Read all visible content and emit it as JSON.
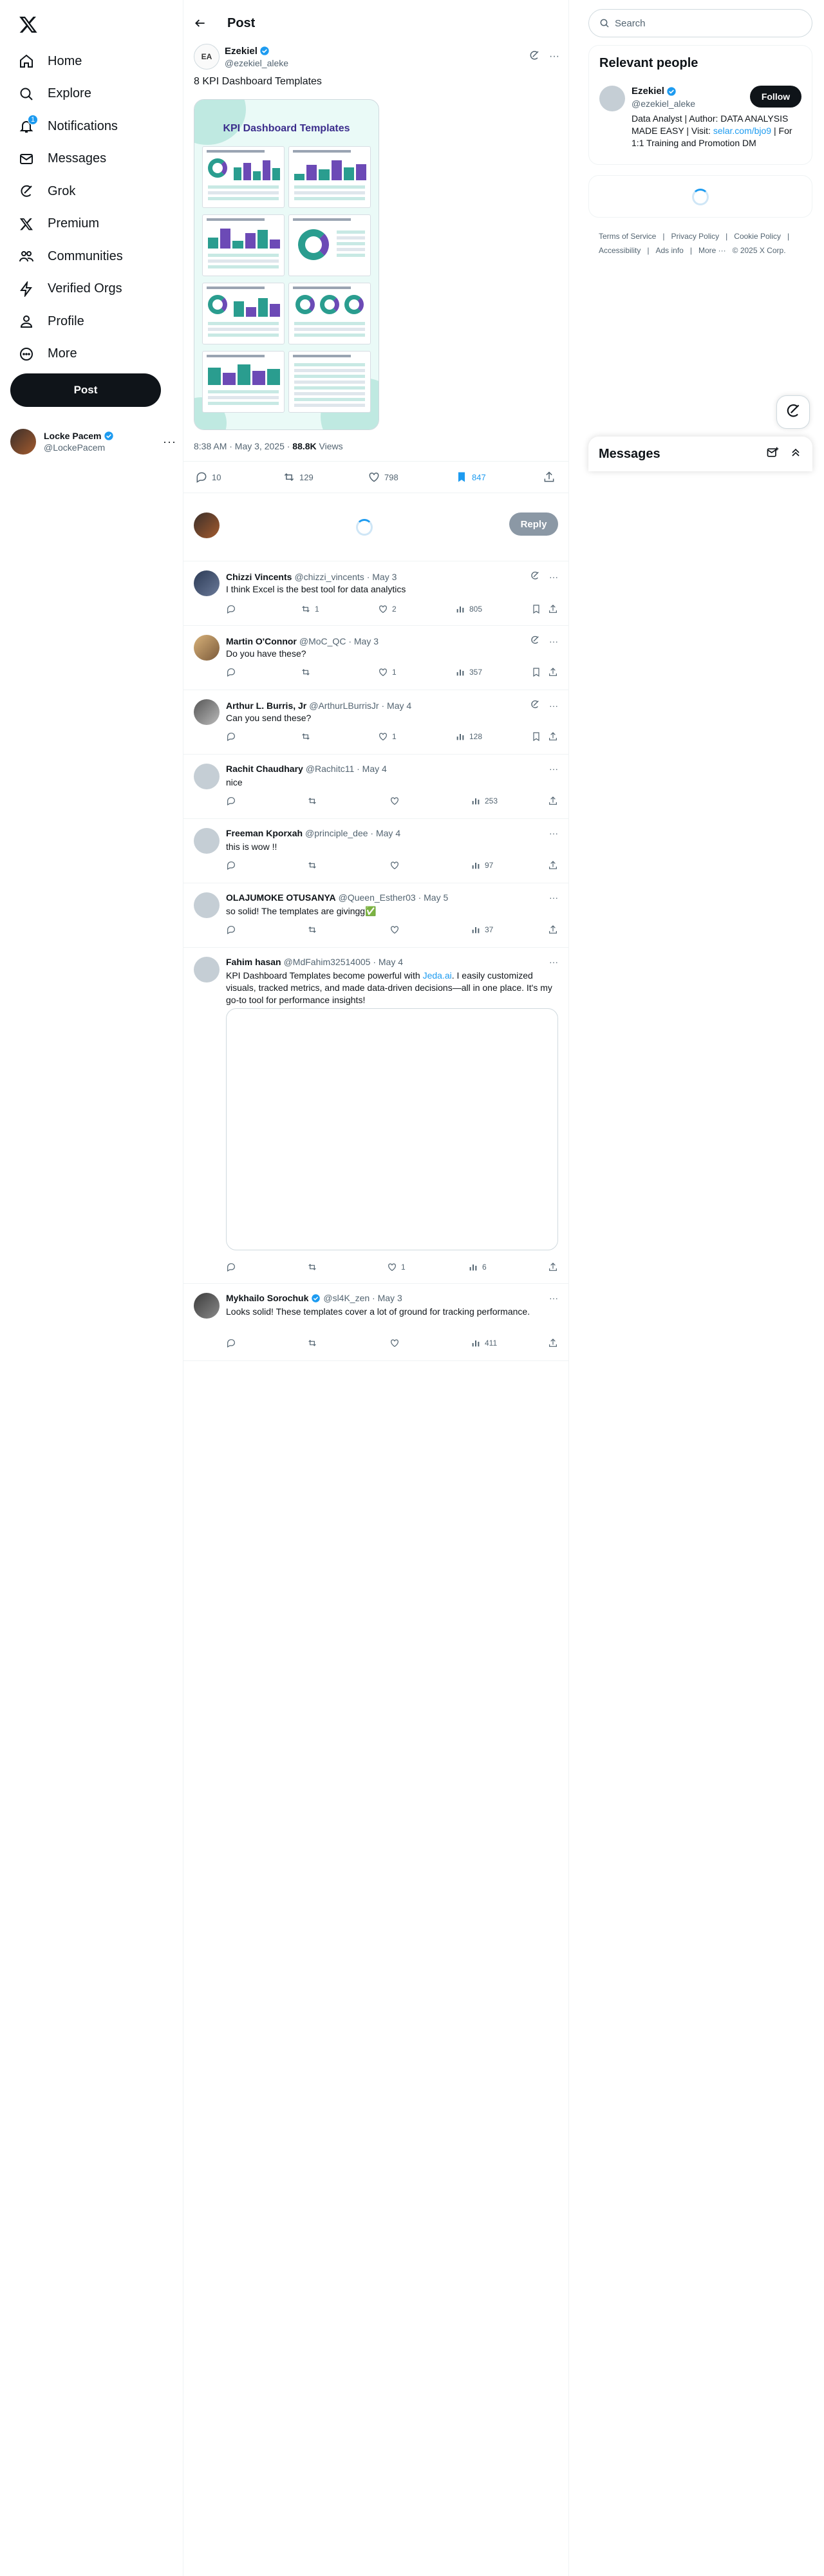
{
  "nav": {
    "items": [
      {
        "label": "Home",
        "icon": "home-icon"
      },
      {
        "label": "Explore",
        "icon": "search-icon"
      },
      {
        "label": "Notifications",
        "icon": "bell-icon",
        "badge": "1"
      },
      {
        "label": "Messages",
        "icon": "envelope-icon"
      },
      {
        "label": "Grok",
        "icon": "grok-icon"
      },
      {
        "label": "Premium",
        "icon": "x-logo-icon"
      },
      {
        "label": "Communities",
        "icon": "people-icon"
      },
      {
        "label": "Verified Orgs",
        "icon": "lightning-icon"
      },
      {
        "label": "Profile",
        "icon": "person-icon"
      },
      {
        "label": "More",
        "icon": "more-circle-icon"
      }
    ],
    "post_button": "Post",
    "account": {
      "name": "Locke Pacem",
      "handle": "@LockePacem"
    }
  },
  "header": {
    "title": "Post"
  },
  "post": {
    "author_initials": "EA",
    "author_name": "Ezekiel",
    "author_handle": "@ezekiel_aleke",
    "text": "8 KPI Dashboard Templates",
    "image_title": "KPI Dashboard Templates",
    "time": "8:38 AM · May 3, 2025 · ",
    "views_count": "88.8K",
    "views_label": " Views",
    "stats": {
      "replies": "10",
      "reposts": "129",
      "likes": "798",
      "bookmarks": "847"
    },
    "accent_color": "#1d9bf0"
  },
  "reply_composer": {
    "button": "Reply"
  },
  "replies": [
    {
      "name": "Chizzi Vincents",
      "handle": "@chizzi_vincents · May 3",
      "text": "I think Excel is the best tool for data analytics",
      "reposts": "1",
      "likes": "2",
      "views": "805"
    },
    {
      "name": "Martin O'Connor",
      "handle": "@MoC_QC · May 3",
      "text": "Do you have these?",
      "reposts": "",
      "likes": "1",
      "views": "357"
    },
    {
      "name": "Arthur L. Burris, Jr",
      "handle": "@ArthurLBurrisJr · May 4",
      "text": "Can you send these?",
      "reposts": "",
      "likes": "1",
      "views": "128"
    },
    {
      "name": "Rachit Chaudhary",
      "handle": "@Rachitc11 · May 4",
      "text": "nice",
      "reposts": "",
      "likes": "",
      "views": "253"
    },
    {
      "name": "Freeman Kporxah",
      "handle": "@principle_dee · May 4",
      "text": "this is wow !!",
      "reposts": "",
      "likes": "",
      "views": "97"
    },
    {
      "name": "OLAJUMOKE OTUSANYA",
      "handle": "@Queen_Esther03 · May 5",
      "text": "so solid! The templates are givingg✅",
      "reposts": "",
      "likes": "",
      "views": "37"
    },
    {
      "name": "Fahim hasan",
      "handle": "@MdFahim32514005 · May 4",
      "text_pre": "KPI Dashboard Templates become powerful with ",
      "text_link": "Jeda.ai",
      "text_post": ". I easily customized visuals, tracked metrics, and made data-driven decisions—all in one place. It's my go-to tool for performance insights!",
      "reposts": "",
      "likes": "1",
      "views": "6"
    },
    {
      "name": "Mykhailo Sorochuk",
      "handle": "@sl4K_zen · May 3",
      "text": "Looks solid! These templates cover a lot of ground for tracking performance.",
      "reposts": "",
      "likes": "",
      "views": "411"
    }
  ],
  "sidebar": {
    "search_placeholder": "Search",
    "relevant_title": "Relevant people",
    "person": {
      "name": "Ezekiel",
      "handle": "@ezekiel_aleke",
      "follow": "Follow",
      "bio_pre": "Data Analyst | Author: DATA ANALYSIS MADE EASY | Visit: ",
      "bio_link": "selar.com/bjo9",
      "bio_post": " | For 1:1 Training and Promotion DM"
    },
    "footer": [
      "Terms of Service",
      "|",
      "Privacy Policy",
      "|",
      "Cookie Policy",
      "|",
      "Accessibility",
      "|",
      "Ads info",
      "|",
      "More ···",
      "© 2025 X Corp."
    ],
    "messages_title": "Messages"
  }
}
